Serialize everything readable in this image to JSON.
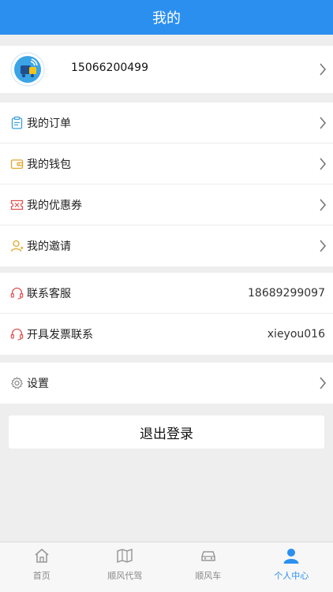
{
  "header": {
    "title": "我的"
  },
  "profile": {
    "phone": "15066200499"
  },
  "menu": {
    "orders": "我的订单",
    "wallet": "我的钱包",
    "coupons": "我的优惠券",
    "invite": "我的邀请"
  },
  "contact": {
    "service_label": "联系客服",
    "service_value": "18689299097",
    "invoice_label": "开具发票联系",
    "invoice_value": "xieyou016"
  },
  "settings": {
    "label": "设置"
  },
  "logout": {
    "label": "退出登录"
  },
  "tabbar": {
    "items": [
      {
        "label": "首页",
        "icon": "home-icon"
      },
      {
        "label": "顺风代驾",
        "icon": "map-icon"
      },
      {
        "label": "顺风车",
        "icon": "car-icon"
      },
      {
        "label": "个人中心",
        "icon": "user-icon"
      }
    ],
    "active_index": 3
  },
  "colors": {
    "accent": "#2b8ff0",
    "background": "#eeeeee"
  }
}
